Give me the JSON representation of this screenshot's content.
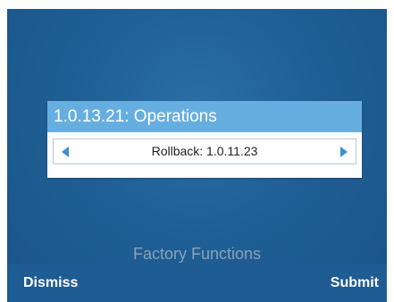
{
  "dialog": {
    "title": "1.0.13.21: Operations",
    "selector": {
      "value": "Rollback: 1.0.11.23",
      "prev_icon": "arrow-left-icon",
      "next_icon": "arrow-right-icon"
    }
  },
  "screen": {
    "caption": "Factory Functions"
  },
  "softkeys": {
    "left_label": "Dismiss",
    "right_label": "Submit"
  },
  "colors": {
    "background": "#1f5f95",
    "dialog_header": "#67aee0",
    "arrow": "#3d8fd1",
    "softkey_bar": "#1e5c93",
    "caption": "#8aa2b8"
  }
}
